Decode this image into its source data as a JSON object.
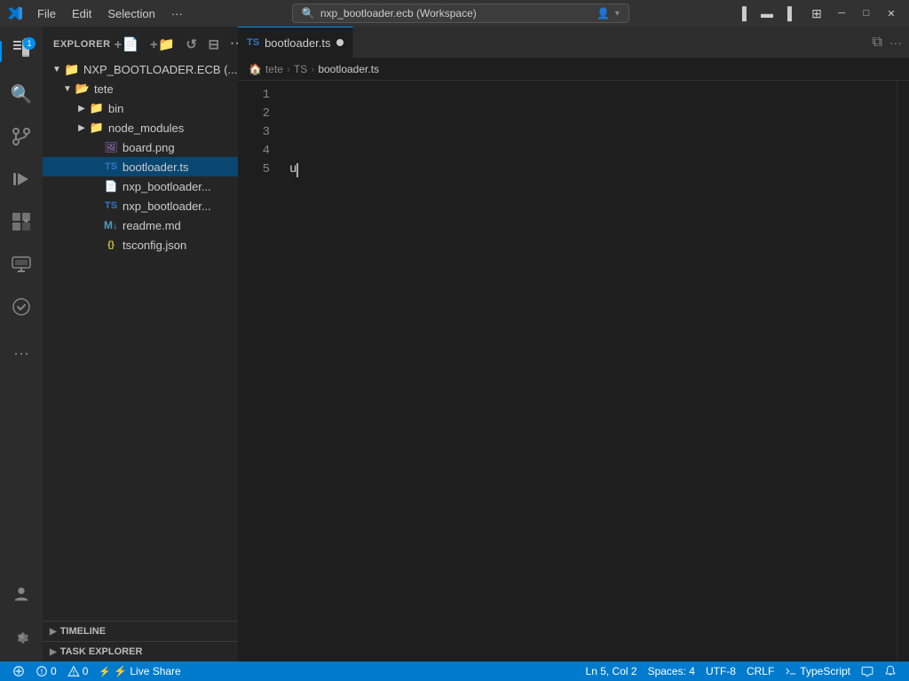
{
  "titlebar": {
    "menu_items": [
      "File",
      "Edit",
      "Selection",
      "···"
    ],
    "search_text": "nxp_bootloader.ecb (Workspace)",
    "window_controls": [
      "─",
      "□",
      "✕"
    ]
  },
  "activity_bar": {
    "icons": [
      {
        "name": "explorer",
        "symbol": "⧉",
        "active": true,
        "badge": "1"
      },
      {
        "name": "search",
        "symbol": "🔍"
      },
      {
        "name": "source-control",
        "symbol": "⎇"
      },
      {
        "name": "run-debug",
        "symbol": "▷"
      },
      {
        "name": "extensions",
        "symbol": "⊞"
      },
      {
        "name": "remote-explorer",
        "symbol": "🖥"
      },
      {
        "name": "task-checker",
        "symbol": "✓"
      }
    ],
    "bottom_icons": [
      {
        "name": "accounts",
        "symbol": "👤"
      },
      {
        "name": "settings",
        "symbol": "⚙"
      }
    ]
  },
  "sidebar": {
    "title": "EXPLORER",
    "more_icon": "···",
    "workspace_root": "NXP_BOOTLOADER.ECB (...",
    "tree": [
      {
        "id": "tete-folder",
        "label": "tete",
        "type": "folder",
        "open": true,
        "level": 0
      },
      {
        "id": "bin-folder",
        "label": "bin",
        "type": "folder",
        "open": false,
        "level": 1
      },
      {
        "id": "node_modules-folder",
        "label": "node_modules",
        "type": "folder",
        "open": false,
        "level": 1
      },
      {
        "id": "board-png",
        "label": "board.png",
        "type": "png",
        "level": 1
      },
      {
        "id": "bootloader-ts",
        "label": "bootloader.ts",
        "type": "ts",
        "level": 1,
        "active": true
      },
      {
        "id": "nxp_bootloader1",
        "label": "nxp_bootloader...",
        "type": "file",
        "level": 1
      },
      {
        "id": "nxp_bootloader2",
        "label": "nxp_bootloader...",
        "type": "ts-file",
        "level": 1
      },
      {
        "id": "readme-md",
        "label": "readme.md",
        "type": "md",
        "level": 1
      },
      {
        "id": "tsconfig-json",
        "label": "tsconfig.json",
        "type": "json",
        "level": 1
      }
    ],
    "timeline_label": "TIMELINE",
    "task_explorer_label": "TASK EXPLORER"
  },
  "editor": {
    "tab_label": "bootloader.ts",
    "tab_icon": "TS",
    "tab_dirty": true,
    "breadcrumb": [
      "tete",
      "TS",
      "bootloader.ts"
    ],
    "lines": [
      "",
      "",
      "",
      "",
      "u"
    ],
    "line_count": 5,
    "cursor_line": 5,
    "cursor_col": 2
  },
  "statusbar": {
    "left": [
      {
        "label": "⓪",
        "type": "remote"
      },
      {
        "label": "⊗ 0",
        "type": "errors"
      },
      {
        "label": "⚠ 0",
        "type": "warnings"
      }
    ],
    "right": [
      {
        "label": "Ln 5, Col 2",
        "type": "position"
      },
      {
        "label": "Spaces: 4",
        "type": "spaces"
      },
      {
        "label": "UTF-8",
        "type": "encoding"
      },
      {
        "label": "CRLF",
        "type": "eol"
      },
      {
        "label": "{ } TypeScript",
        "type": "language"
      },
      {
        "label": "🔔",
        "type": "notifications"
      }
    ],
    "live_share": "⚡ Live Share"
  }
}
